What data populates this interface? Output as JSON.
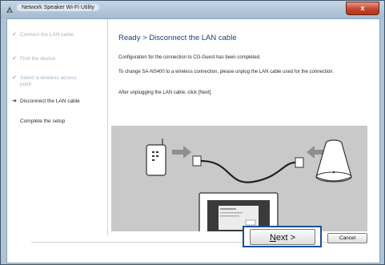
{
  "window": {
    "title": "Network Speaker Wi-Fi Utility",
    "close_label": "x"
  },
  "steps": [
    {
      "mark": "✔",
      "label": "Connect the LAN cable",
      "state": "done"
    },
    {
      "mark": "✔",
      "label": "Find the device",
      "state": "done"
    },
    {
      "mark": "✔",
      "label": "Select a wireless access point",
      "state": "done"
    },
    {
      "mark": "➔",
      "label": "Disconnect the LAN cable",
      "state": "current"
    },
    {
      "mark": "",
      "label": "Complete the setup",
      "state": "upcoming"
    }
  ],
  "content": {
    "heading": "Ready > Disconnect the LAN cable",
    "para1": "Configuration for the connection to CG-Guest has been completed.",
    "para2": "To change SA-NS400 to a wireless connection, please unplug the LAN cable used for the connection.",
    "para3": "After unplugging the LAN cable, click [Next]."
  },
  "buttons": {
    "next_accel": "N",
    "next_rest": "ext >",
    "cancel": "Cancel"
  },
  "colors": {
    "heading": "#1f3e75",
    "done_step": "#a3b5c4",
    "highlight": "#1b4f9c"
  }
}
